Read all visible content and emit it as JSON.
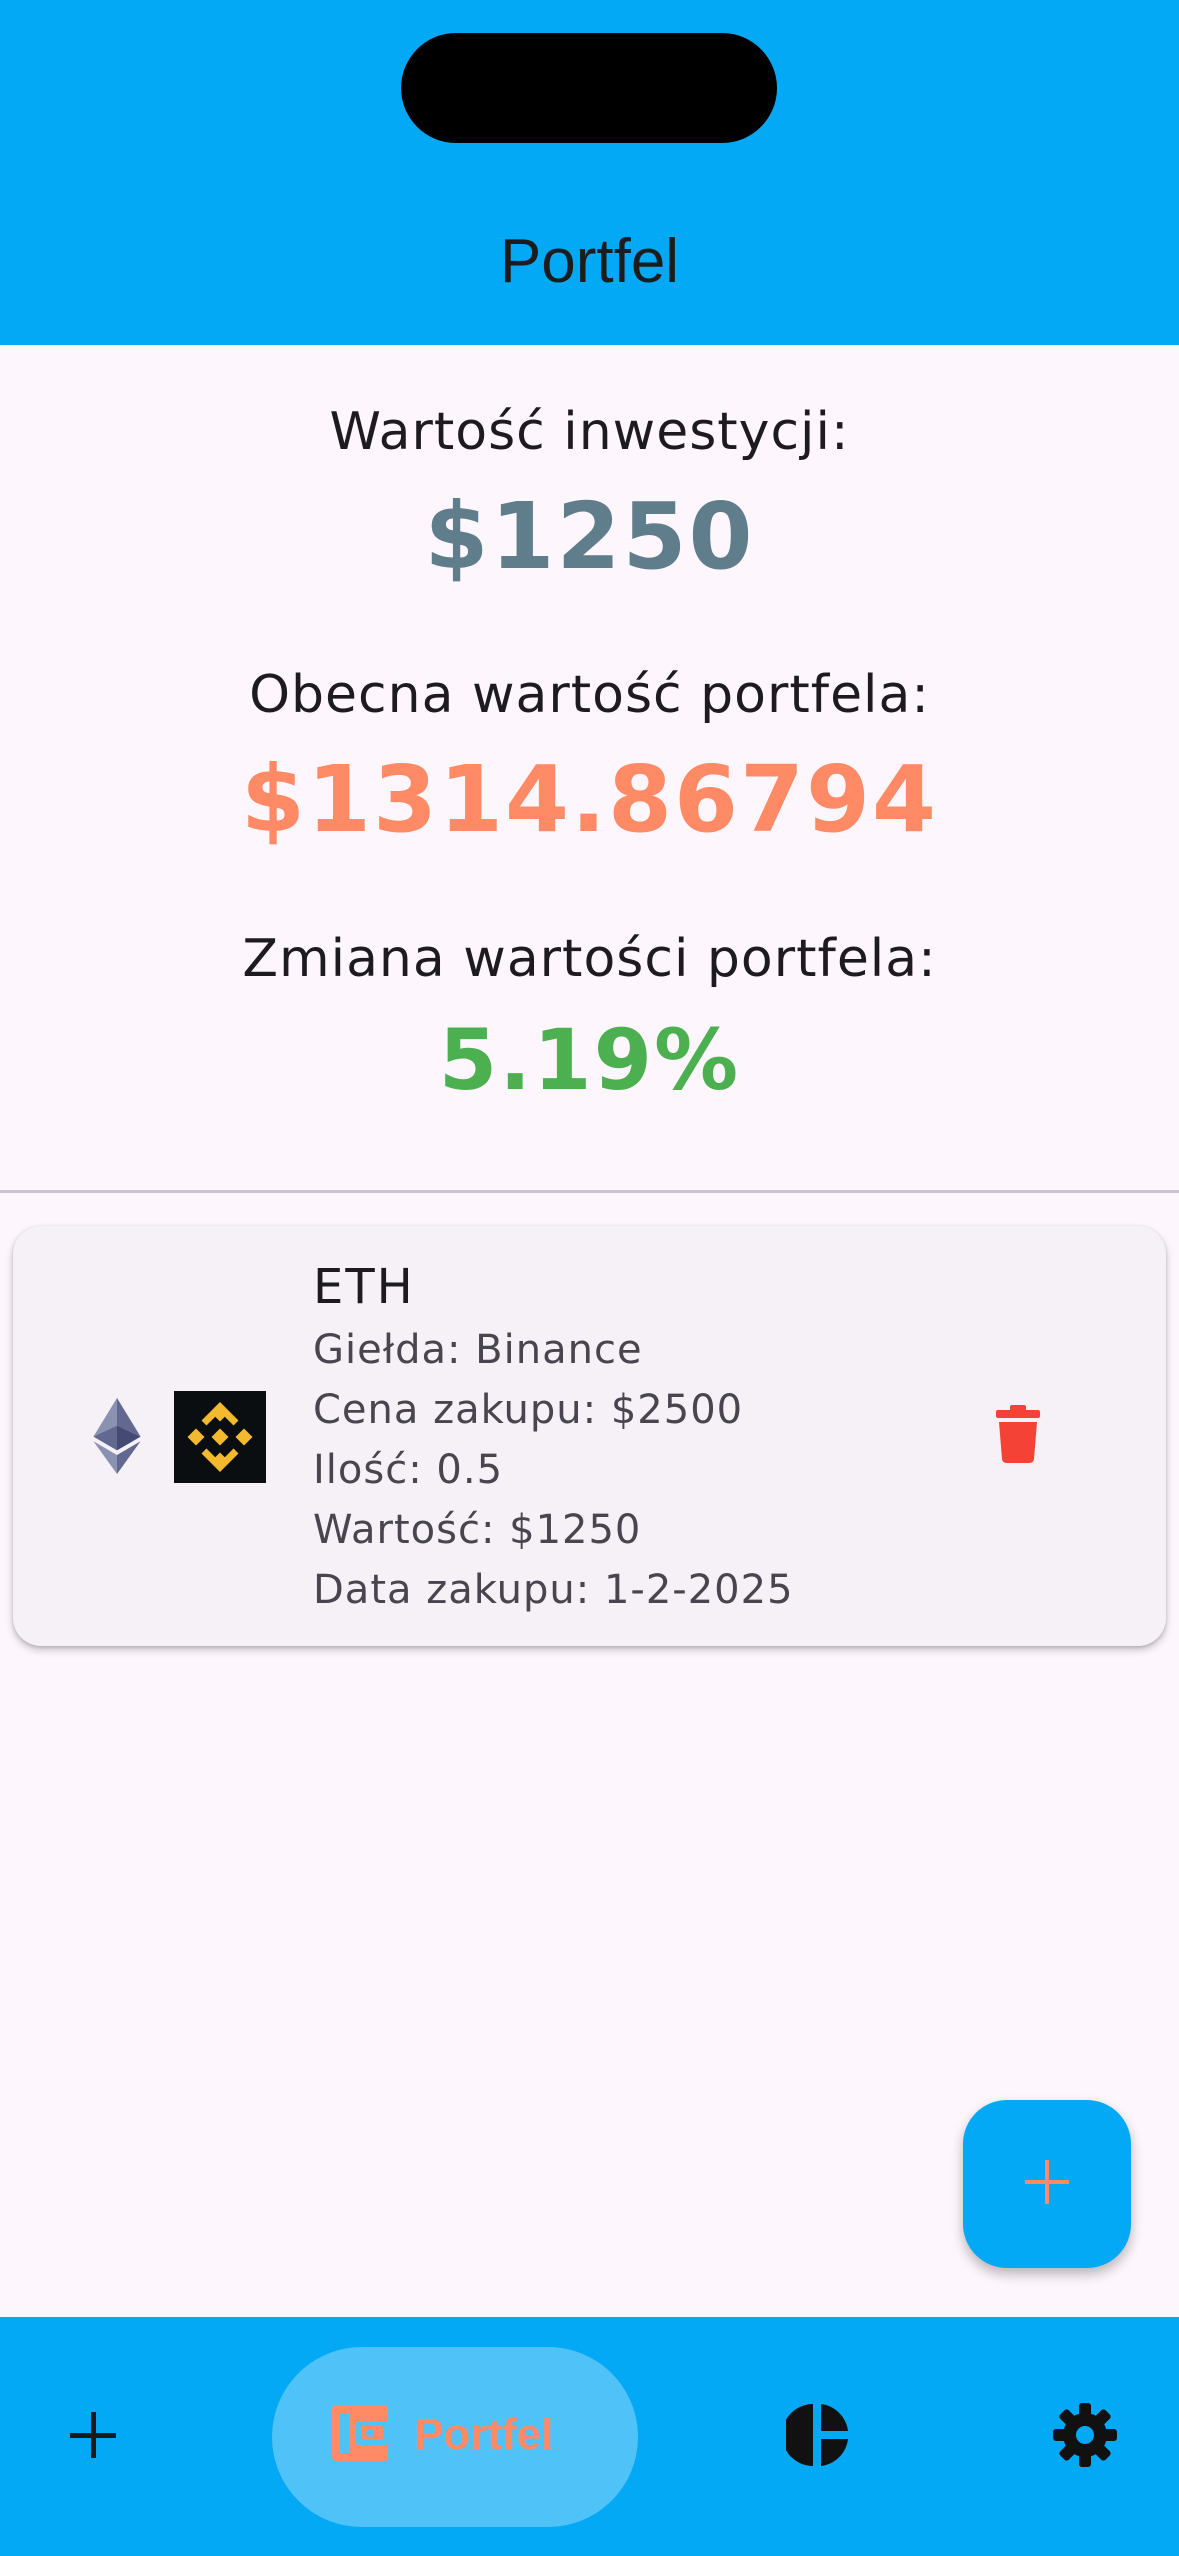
{
  "app": {
    "title": "Portfel"
  },
  "summary": {
    "investment_label": "Wartość inwestycji:",
    "investment_value": "$1250",
    "current_label": "Obecna wartość portfela:",
    "current_value": "$1314.86794",
    "change_label": "Zmiana wartości portfela:",
    "change_value": "5.19%"
  },
  "holdings": [
    {
      "symbol": "ETH",
      "coin_icon": "ethereum-icon",
      "exchange_icon": "binance-logo",
      "exchange": "Giełda: Binance",
      "price": "Cena zakupu: $2500",
      "quantity": "Ilość: 0.5",
      "value": "Wartość: $1250",
      "date": "Data zakupu: 1-2-2025"
    }
  ],
  "fab": {
    "icon": "plus-icon"
  },
  "bottom_nav": {
    "items": [
      {
        "icon": "plus-icon",
        "label": ""
      },
      {
        "icon": "wallet-icon",
        "label": "Portfel",
        "selected": true
      },
      {
        "icon": "pie-chart-icon",
        "label": ""
      },
      {
        "icon": "gear-icon",
        "label": ""
      }
    ]
  },
  "colors": {
    "primary": "#03A9F4",
    "accent": "#FF8A65",
    "investment_value": "#607D8B",
    "positive_change": "#4CAF50",
    "delete": "#F44336",
    "nav_selected_pill": "#4FC3F7"
  }
}
